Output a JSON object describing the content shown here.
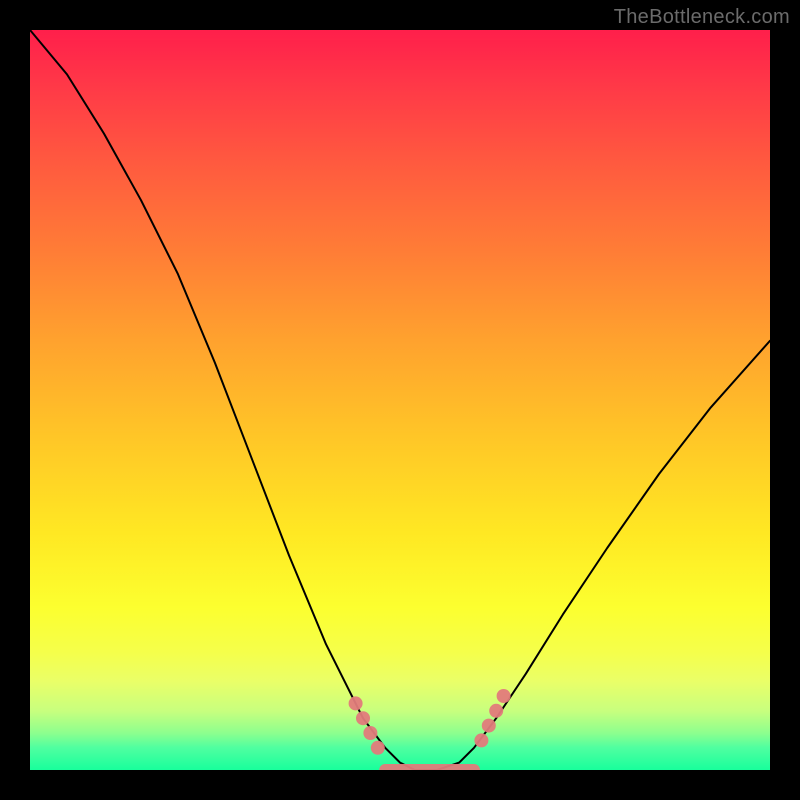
{
  "watermark": {
    "text": "TheBottleneck.com"
  },
  "chart_data": {
    "type": "line",
    "title": "",
    "xlabel": "",
    "ylabel": "",
    "xlim": [
      0,
      100
    ],
    "ylim": [
      0,
      100
    ],
    "background_gradient": {
      "direction": "vertical",
      "stops": [
        {
          "pos": 0,
          "color": "#ff1f4b"
        },
        {
          "pos": 30,
          "color": "#ff7d36"
        },
        {
          "pos": 55,
          "color": "#ffc627"
        },
        {
          "pos": 78,
          "color": "#fcff2f"
        },
        {
          "pos": 92,
          "color": "#c8ff7e"
        },
        {
          "pos": 100,
          "color": "#18ff9c"
        }
      ]
    },
    "series": [
      {
        "name": "bottleneck-curve",
        "x": [
          0,
          5,
          10,
          15,
          20,
          25,
          30,
          35,
          40,
          45,
          48,
          50,
          52,
          55,
          58,
          60,
          63,
          67,
          72,
          78,
          85,
          92,
          100
        ],
        "values": [
          100,
          94,
          86,
          77,
          67,
          55,
          42,
          29,
          17,
          7,
          3,
          1,
          0,
          0,
          1,
          3,
          7,
          13,
          21,
          30,
          40,
          49,
          58
        ]
      }
    ],
    "markers": {
      "name": "optimal-range",
      "color": "#e27b7b",
      "flat_segment": {
        "x_start": 48,
        "x_end": 60,
        "y": 0
      },
      "dots": [
        {
          "x": 44,
          "y": 9
        },
        {
          "x": 45,
          "y": 7
        },
        {
          "x": 46,
          "y": 5
        },
        {
          "x": 47,
          "y": 3
        },
        {
          "x": 61,
          "y": 4
        },
        {
          "x": 62,
          "y": 6
        },
        {
          "x": 63,
          "y": 8
        },
        {
          "x": 64,
          "y": 10
        }
      ]
    }
  }
}
